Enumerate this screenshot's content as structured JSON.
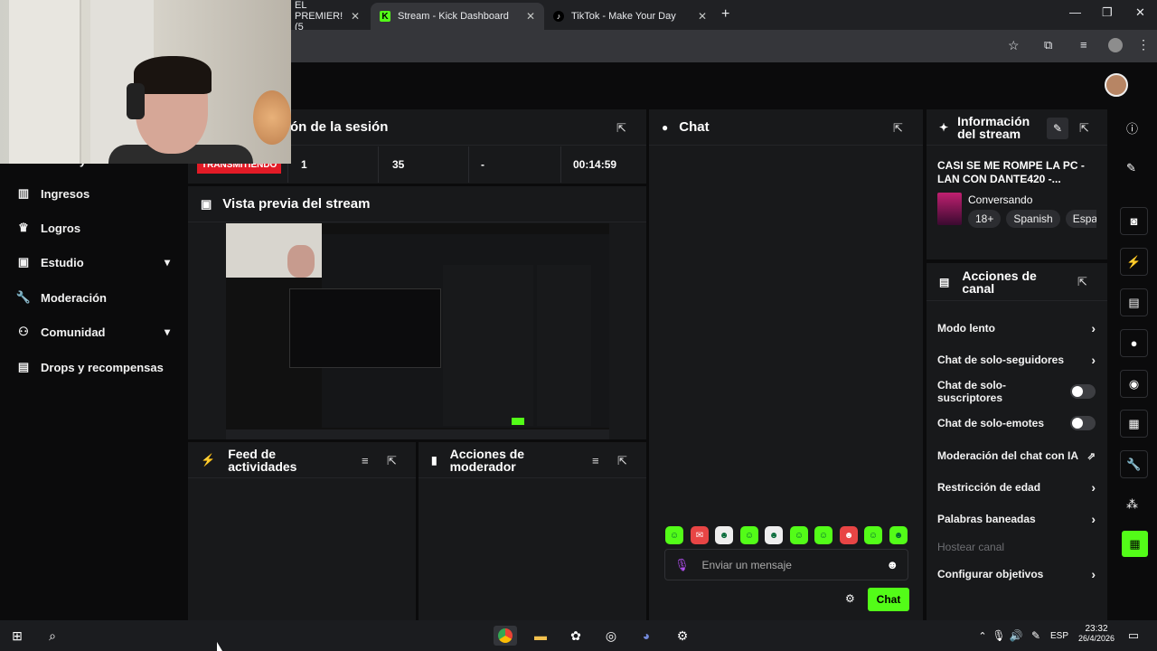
{
  "browser": {
    "tabs": [
      {
        "title": "EL PREMIER! (5"
      },
      {
        "title": "Stream - Kick Dashboard"
      },
      {
        "title": "TikTok - Make Your Day"
      }
    ],
    "new_tab": "+"
  },
  "sidebar": {
    "partial_item": "y",
    "items": [
      {
        "label": "Ingresos",
        "icon": "bar-chart-icon"
      },
      {
        "label": "Logros",
        "icon": "trophy-icon"
      },
      {
        "label": "Estudio",
        "icon": "studio-icon",
        "expand": true
      },
      {
        "label": "Moderación",
        "icon": "wrench-icon"
      },
      {
        "label": "Comunidad",
        "icon": "people-icon",
        "expand": true
      },
      {
        "label": "Drops y recompensas",
        "icon": "gift-chart-icon"
      }
    ]
  },
  "session": {
    "title": "ón de la sesión",
    "status": "TRANSMITIENDO",
    "stats": [
      "1",
      "35",
      "-",
      "00:14:59"
    ]
  },
  "preview": {
    "title": "Vista previa del stream"
  },
  "feed": {
    "title": "Feed de actividades"
  },
  "mod_actions": {
    "title": "Acciones de moderador"
  },
  "chat": {
    "title": "Chat",
    "placeholder": "Enviar un mensaje",
    "send_label": "Chat"
  },
  "stream_info": {
    "title": "Información del stream",
    "stream_title": "CASI SE ME ROMPE LA PC - LAN CON DANTE420 -...",
    "category": "Conversando",
    "tags": [
      "18+",
      "Spanish",
      "Españ"
    ]
  },
  "channel_actions": {
    "title": "Acciones de canal",
    "items": [
      {
        "label": "Modo lento",
        "kind": "chevron"
      },
      {
        "label": "Chat de solo-seguidores",
        "kind": "chevron"
      },
      {
        "label": "Chat de solo-suscriptores",
        "kind": "toggle",
        "on": false
      },
      {
        "label": "Chat de solo-emotes",
        "kind": "toggle",
        "on": false
      },
      {
        "label": "Moderación del chat con IA",
        "kind": "external"
      },
      {
        "label": "Restricción de edad",
        "kind": "chevron"
      },
      {
        "label": "Palabras baneadas",
        "kind": "chevron"
      },
      {
        "label": "Hostear canal",
        "kind": "disabled"
      },
      {
        "label": "Configurar objetivos",
        "kind": "chevron"
      }
    ]
  },
  "taskbar": {
    "time": "23:32",
    "date": "26/4/2026",
    "lang": "ESP"
  },
  "colors": {
    "kick_green": "#53fc18",
    "live_red": "#e21b26",
    "panel": "#18191b",
    "bg": "#0b0b0c"
  }
}
